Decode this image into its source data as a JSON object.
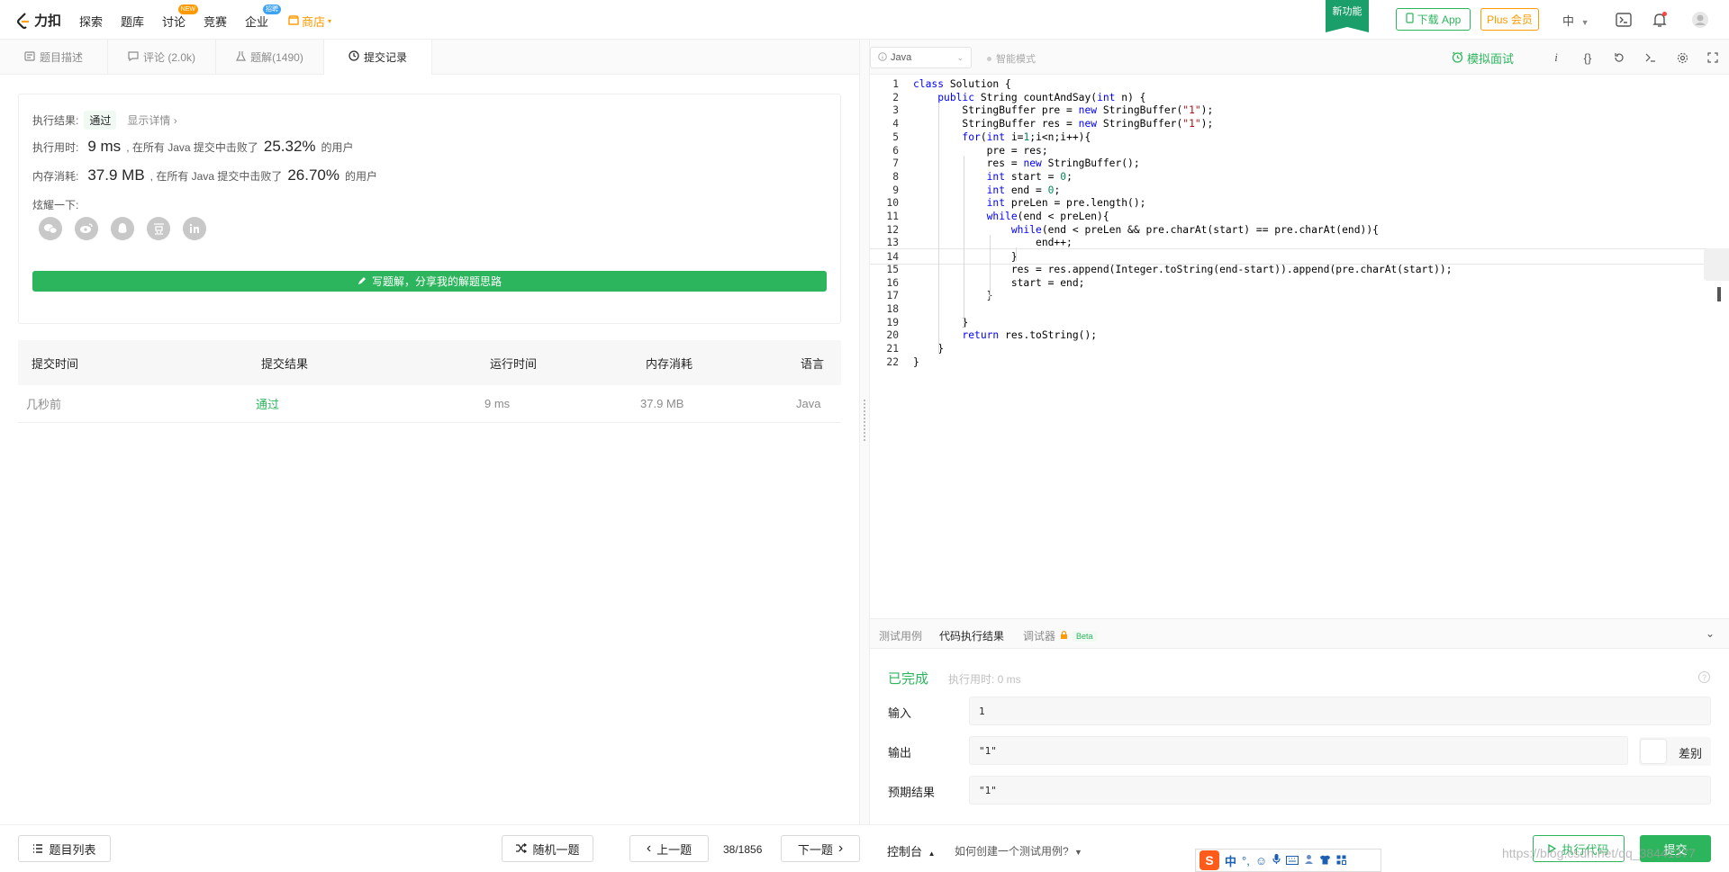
{
  "topnav": {
    "logo_text": "力扣",
    "items": [
      {
        "label": "探索"
      },
      {
        "label": "题库"
      },
      {
        "label": "讨论",
        "badge": "NEW"
      },
      {
        "label": "竞赛"
      },
      {
        "label": "企业",
        "badge": "招聘"
      },
      {
        "label": "商店"
      }
    ],
    "new_feature": "新功能",
    "download_app": "下载 App",
    "plus": "Plus 会员",
    "language": "中"
  },
  "left_tabs": [
    {
      "label": "题目描述",
      "icon": "document-icon"
    },
    {
      "label": "评论 (2.0k)",
      "icon": "comment-icon"
    },
    {
      "label": "题解(1490)",
      "icon": "flask-icon"
    },
    {
      "label": "提交记录",
      "icon": "clock-icon"
    }
  ],
  "result": {
    "exec_result_label": "执行结果:",
    "exec_result_value": "通过",
    "show_details": "显示详情 ›",
    "time_label": "执行用时:",
    "time_value": "9 ms",
    "time_mid": ", 在所有 Java 提交中击败了",
    "time_percent": "25.32%",
    "time_suffix": "的用户",
    "mem_label": "内存消耗:",
    "mem_value": "37.9 MB",
    "mem_mid": ", 在所有 Java 提交中击败了",
    "mem_percent": "26.70%",
    "mem_suffix": "的用户",
    "share_label": "炫耀一下:",
    "share_icons": [
      "wechat-icon",
      "weibo-icon",
      "qq-icon",
      "douban-icon",
      "linkedin-icon"
    ],
    "write_solution": "写题解，分享我的解题思路"
  },
  "submissions": {
    "headers": [
      "提交时间",
      "提交结果",
      "运行时间",
      "内存消耗",
      "语言"
    ],
    "rows": [
      {
        "time": "几秒前",
        "result": "通过",
        "runtime": "9 ms",
        "memory": "37.9 MB",
        "language": "Java"
      }
    ]
  },
  "editor_toolbar": {
    "language": "Java",
    "smart_mode": "智能模式",
    "mock_interview": "模拟面试"
  },
  "code_lines": [
    "class Solution {",
    "    public String countAndSay(int n) {",
    "        StringBuffer pre = new StringBuffer(\"1\");",
    "        StringBuffer res = new StringBuffer(\"1\");",
    "        for(int i=1;i<n;i++){",
    "            pre = res;",
    "            res = new StringBuffer();",
    "            int start = 0;",
    "            int end = 0;",
    "            int preLen = pre.length();",
    "            while(end < preLen){",
    "                while(end < preLen && pre.charAt(start) == pre.charAt(end)){",
    "                    end++;",
    "                }",
    "                res = res.append(Integer.toString(end-start)).append(pre.charAt(start));",
    "                start = end;",
    "            }",
    "",
    "        }",
    "        return res.toString();",
    "    }",
    "}"
  ],
  "console": {
    "tabs": [
      "测试用例",
      "代码执行结果",
      "调试器"
    ],
    "beta": "Beta",
    "status": "已完成",
    "exec_time": "执行用时: 0 ms",
    "input_label": "输入",
    "input_value": "1",
    "output_label": "输出",
    "output_value": "\"1\"",
    "diff_label": "差别",
    "expected_label": "预期结果",
    "expected_value": "\"1\""
  },
  "bottom": {
    "problem_list": "题目列表",
    "random": "随机一题",
    "prev": "上一题",
    "page": "38/1856",
    "next": "下一题",
    "console": "控制台",
    "howto": "如何创建一个测试用例?",
    "run": "执行代码",
    "submit": "提交"
  },
  "ime": {
    "logo": "S",
    "items": [
      "中",
      "°,",
      "☺",
      "🎤",
      "⌨",
      "👤",
      "👕",
      "▦"
    ]
  },
  "watermark": "https://blog.csdn.net/qq_38441377"
}
